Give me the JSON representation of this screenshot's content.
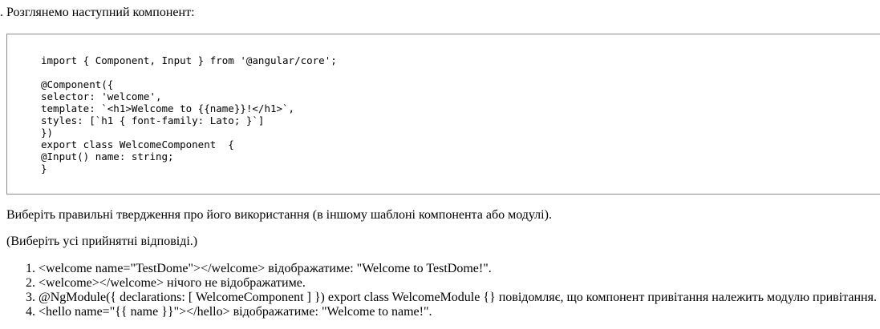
{
  "intro": ". Розглянемо наступний компонент:",
  "code": {
    "import_line": "import { Component, Input } from '@angular/core';",
    "lines": [
      "@Component({",
      "selector: 'welcome',",
      "template: `<h1>Welcome to {{name}}!</h1>`,",
      "styles: [`h1 { font-family: Lato; }`]",
      "})",
      "export class WelcomeComponent  {",
      "@Input() name: string;",
      "}"
    ]
  },
  "question": "Виберіть правильні твердження про його використання (в іншому шаблоні компонента або модулі).",
  "hint": "(Виберіть усі прийнятні відповіді.)",
  "answers": [
    "<welcome name=\"TestDome\"></welcome> відображатиме: \"Welcome to TestDome!\".",
    "<welcome></welcome> нічого не відображатиме.",
    "@NgModule({ declarations: [ WelcomeComponent ] }) export class WelcomeModule {} повідомляє, що компонент привітання належить модулю привітання.",
    "<hello name=\"{{ name }}\"></hello> відображатиме: \"Welcome to name!\"."
  ]
}
